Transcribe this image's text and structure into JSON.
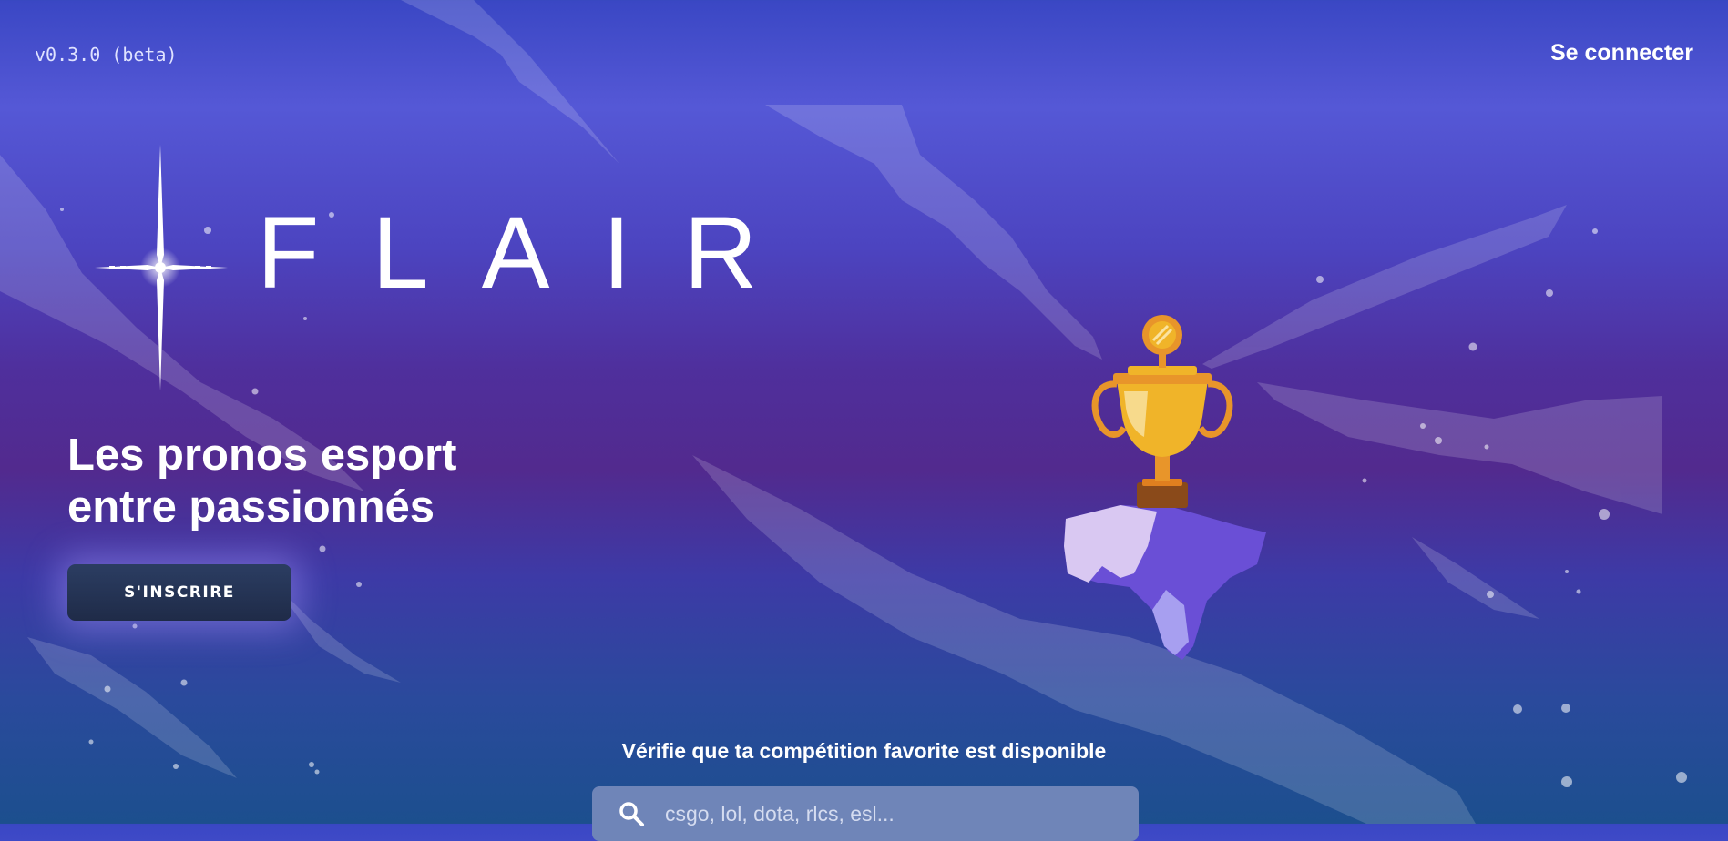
{
  "header": {
    "version": "v0.3.0 (beta)",
    "login_label": "Se connecter"
  },
  "brand": {
    "name": "FLAIR",
    "icon": "sparkle-star-icon"
  },
  "hero": {
    "tagline_line1": "Les pronos esport",
    "tagline_line2": "entre passionnés",
    "signup_label": "S'INSCRIRE",
    "illustration": "trophy-on-floating-rock"
  },
  "search": {
    "title": "Vérifie que ta compétition favorite est disponible",
    "placeholder": "csgo, lol, dota, rlcs, esl...",
    "value": "",
    "icon": "search-icon"
  },
  "colors": {
    "bg_top": "#3a47c4",
    "bg_mid": "#522a8e",
    "bg_bottom": "#1c4f8e",
    "button": "#1f2b48",
    "search_box": "#6f85b8",
    "trophy_gold": "#f0b429"
  }
}
